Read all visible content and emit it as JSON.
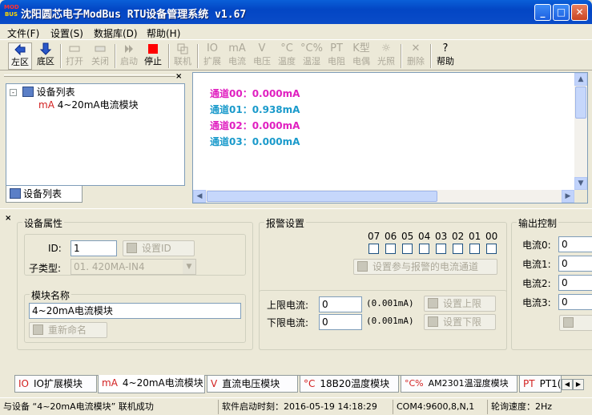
{
  "window": {
    "title": "沈阳圆芯电子ModBus RTU设备管理系统 v1.67",
    "icon_text_top": "MOD",
    "icon_text_bottom": "BUS",
    "controls": {
      "minimize": "_",
      "maximize": "□",
      "close": "✕"
    }
  },
  "menu": [
    {
      "label": "文件(F)"
    },
    {
      "label": "设置(S)"
    },
    {
      "label": "数据库(D)"
    },
    {
      "label": "帮助(H)"
    }
  ],
  "toolbar": {
    "left_area": {
      "label": "左区",
      "icon": "arrow-left-icon"
    },
    "bottom_area": {
      "label": "底区",
      "icon": "arrow-down-icon"
    },
    "open": {
      "label": "打开",
      "icon": "open-port-icon"
    },
    "close": {
      "label": "关闭",
      "icon": "close-port-icon"
    },
    "start": {
      "label": "启动",
      "icon": "play-icon"
    },
    "stop": {
      "label": "停止",
      "icon": "stop-icon"
    },
    "connect": {
      "label": "联机",
      "icon": "connect-icon"
    },
    "io_ext": {
      "label": "扩展",
      "icon_text": "IO"
    },
    "current": {
      "label": "电流",
      "icon_text": "mA"
    },
    "voltage": {
      "label": "电压",
      "icon_text": "V"
    },
    "temp": {
      "label": "温度",
      "icon_text": "°C"
    },
    "humidity": {
      "label": "温湿",
      "icon_text": "°C%"
    },
    "resistance": {
      "label": "电阻",
      "icon_text": "PT"
    },
    "thermocouple": {
      "label": "电偶",
      "icon_text": "K型"
    },
    "light": {
      "label": "光照",
      "icon_text": "☼"
    },
    "delete": {
      "label": "删除",
      "icon_text": "✕"
    },
    "help": {
      "label": "帮助",
      "icon_text": "?"
    }
  },
  "tree": {
    "root": "设备列表",
    "children": [
      {
        "icon_text": "mA",
        "label": "4~20mA电流模块"
      }
    ],
    "tab_label": "设备列表"
  },
  "display": {
    "channels": [
      {
        "label": "通道00：",
        "value": "0.000mA",
        "color": "#e020c0"
      },
      {
        "label": "通道01：",
        "value": "0.938mA",
        "color": "#1a9acb"
      },
      {
        "label": "通道02：",
        "value": "0.000mA",
        "color": "#e020c0"
      },
      {
        "label": "通道03：",
        "value": "0.000mA",
        "color": "#1a9acb"
      }
    ]
  },
  "device_props": {
    "title": "设备属性",
    "id_label": "ID:",
    "id_value": "1",
    "set_id_button": "设置ID",
    "subtype_label": "子类型:",
    "subtype_value": "01. 420MA-IN4",
    "module_name_title": "模块名称",
    "module_name_value": "4~20mA电流模块",
    "rename_button": "重新命名"
  },
  "alarm": {
    "title": "报警设置",
    "channels": [
      "07",
      "06",
      "05",
      "04",
      "03",
      "02",
      "01",
      "00"
    ],
    "set_channels_button": "设置参与报警的电流通道",
    "upper_label": "上限电流:",
    "upper_value": "0",
    "upper_unit": "(0.001mA)",
    "set_upper_button": "设置上限",
    "lower_label": "下限电流:",
    "lower_value": "0",
    "lower_unit": "(0.001mA)",
    "set_lower_button": "设置下限"
  },
  "output": {
    "title": "输出控制",
    "rows": [
      {
        "label": "电流0:",
        "value": "0"
      },
      {
        "label": "电流1:",
        "value": "0"
      },
      {
        "label": "电流2:",
        "value": "0"
      },
      {
        "label": "电流3:",
        "value": "0"
      }
    ]
  },
  "bottom_tabs": [
    {
      "icon_text": "IO",
      "label": "IO扩展模块"
    },
    {
      "icon_text": "mA",
      "label": "4~20mA电流模块"
    },
    {
      "icon_text": "V",
      "label": "直流电压模块"
    },
    {
      "icon_text": "°C",
      "label": "18B20温度模块"
    },
    {
      "icon_text": "°C%",
      "label": "AM2301温湿度模块"
    },
    {
      "icon_text": "PT",
      "label": "PT1("
    }
  ],
  "status": {
    "message": "与设备 “4~20mA电流模块” 联机成功",
    "start_time": "软件启动时刻：2016-05-19 14:18:29",
    "port": "COM4:9600,8,N,1",
    "poll_speed": "轮询速度：2Hz"
  }
}
